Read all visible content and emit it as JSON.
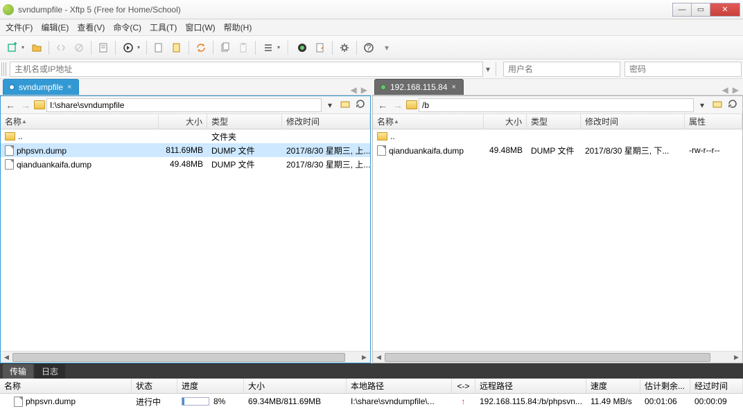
{
  "window": {
    "title": "svndumpfile - Xftp 5 (Free for Home/School)"
  },
  "menu": [
    "文件(F)",
    "编辑(E)",
    "查看(V)",
    "命令(C)",
    "工具(T)",
    "窗口(W)",
    "帮助(H)"
  ],
  "hostbar": {
    "host_ph": "主机名或IP地址",
    "user_ph": "用户名",
    "pass_ph": "密码"
  },
  "tabs": {
    "left": "svndumpfile",
    "right": "192.168.115.84"
  },
  "left": {
    "path": "I:\\share\\svndumpfile",
    "cols": {
      "name": "名称",
      "size": "大小",
      "type": "类型",
      "mtime": "修改时间"
    },
    "col_w": {
      "name": 228,
      "size": 70,
      "type": 108,
      "mtime": 140
    },
    "rows": [
      {
        "kind": "up",
        "name": "..",
        "type": "文件夹"
      },
      {
        "kind": "file",
        "name": "phpsvn.dump",
        "size": "811.69MB",
        "type": "DUMP 文件",
        "mtime": "2017/8/30 星期三, 上...",
        "sel": true
      },
      {
        "kind": "file",
        "name": "qianduankaifa.dump",
        "size": "49.48MB",
        "type": "DUMP 文件",
        "mtime": "2017/8/30 星期三, 上..."
      }
    ]
  },
  "right": {
    "path": "/b",
    "cols": {
      "name": "名称",
      "size": "大小",
      "type": "类型",
      "mtime": "修改时间",
      "attr": "属性"
    },
    "col_w": {
      "name": 160,
      "size": 62,
      "type": 78,
      "mtime": 150,
      "attr": 70
    },
    "rows": [
      {
        "kind": "up",
        "name": ".."
      },
      {
        "kind": "file",
        "name": "qianduankaifa.dump",
        "size": "49.48MB",
        "type": "DUMP 文件",
        "mtime": "2017/8/30 星期三, 下...",
        "attr": "-rw-r--r--"
      }
    ]
  },
  "bottom_tabs": {
    "transfer": "传输",
    "log": "日志"
  },
  "transfer": {
    "cols": {
      "name": "名称",
      "status": "状态",
      "progress": "进度",
      "size": "大小",
      "local": "本地路径",
      "dir": "<->",
      "remote": "远程路径",
      "speed": "速度",
      "eta": "估计剩余...",
      "elapsed": "经过时间"
    },
    "col_w": {
      "name": 190,
      "status": 66,
      "progress": 96,
      "size": 148,
      "local": 152,
      "dir": 34,
      "remote": 160,
      "speed": 78,
      "eta": 72,
      "elapsed": 70
    },
    "row": {
      "name": "phpsvn.dump",
      "status": "进行中",
      "pct": "8%",
      "pct_val": 8,
      "size": "69.34MB/811.69MB",
      "local": "I:\\share\\svndumpfile\\...",
      "remote": "192.168.115.84:/b/phpsvn...",
      "speed": "11.49 MB/s",
      "eta": "00:01:06",
      "elapsed": "00:00:09"
    }
  }
}
